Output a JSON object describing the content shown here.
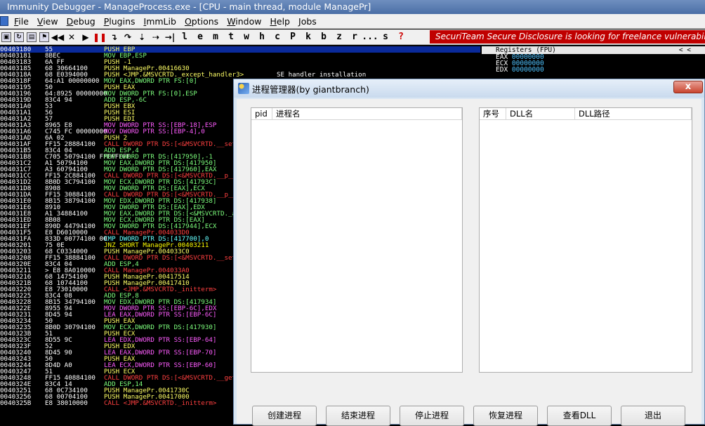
{
  "window": {
    "title": "Immunity Debugger - ManageProcess.exe - [CPU - main thread, module ManagePr]"
  },
  "menu": [
    "File",
    "View",
    "Debug",
    "Plugins",
    "ImmLib",
    "Options",
    "Window",
    "Help",
    "Jobs"
  ],
  "toolbar": {
    "letters": [
      "l",
      "e",
      "m",
      "t",
      "w",
      "h",
      "c",
      "P",
      "k",
      "b",
      "z",
      "r",
      "...",
      "s",
      "?"
    ],
    "banner": "SecuriTeam Secure Disclosure is looking for freelance vulnerability researchers"
  },
  "registers": {
    "header": "Registers (FPU)",
    "arrows": "<      <",
    "rows": [
      {
        "name": "EAX",
        "value": "00000000"
      },
      {
        "name": "ECX",
        "value": "00000000"
      },
      {
        "name": "EDX",
        "value": "00000000"
      }
    ]
  },
  "disasm": [
    {
      "addr": "00403180",
      "hex": "55",
      "asm": "PUSH EBP",
      "cmt": "",
      "kind": "push",
      "selected": true
    },
    {
      "addr": "00403181",
      "hex": "8BEC",
      "asm": "MOV EBP,ESP",
      "cmt": "",
      "kind": "def"
    },
    {
      "addr": "00403183",
      "hex": "6A FF",
      "asm": "PUSH -1",
      "cmt": "",
      "kind": "push"
    },
    {
      "addr": "00403185",
      "hex": "68 30664100",
      "asm": "PUSH ManagePr.00416630",
      "cmt": "",
      "kind": "push"
    },
    {
      "addr": "0040318A",
      "hex": "68 E0394000",
      "asm": "PUSH <JMP.&MSVCRTD._except_handler3>",
      "cmt": "SE handler installation",
      "kind": "push"
    },
    {
      "addr": "0040318F",
      "hex": "64:A1 00000000",
      "asm": "MOV EAX,DWORD PTR FS:[0]",
      "cmt": "",
      "kind": "def"
    },
    {
      "addr": "00403195",
      "hex": "50",
      "asm": "PUSH EAX",
      "cmt": "",
      "kind": "push"
    },
    {
      "addr": "00403196",
      "hex": "64:8925 00000000",
      "asm": "MOV DWORD PTR FS:[0],ESP",
      "cmt": "",
      "kind": "def"
    },
    {
      "addr": "0040319D",
      "hex": "83C4 94",
      "asm": "ADD ESP,-6C",
      "cmt": "",
      "kind": "def"
    },
    {
      "addr": "004031A0",
      "hex": "53",
      "asm": "PUSH EBX",
      "cmt": "",
      "kind": "push"
    },
    {
      "addr": "004031A1",
      "hex": "56",
      "asm": "PUSH ESI",
      "cmt": "",
      "kind": "push"
    },
    {
      "addr": "004031A2",
      "hex": "57",
      "asm": "PUSH EDI",
      "cmt": "",
      "kind": "push"
    },
    {
      "addr": "004031A3",
      "hex": "8965 E8",
      "asm": "MOV DWORD PTR SS:[EBP-18],ESP",
      "cmt": "",
      "kind": "mem"
    },
    {
      "addr": "004031A6",
      "hex": "C745 FC 00000000",
      "asm": "MOV DWORD PTR SS:[EBP-4],0",
      "cmt": "",
      "kind": "mem"
    },
    {
      "addr": "004031AD",
      "hex": "6A 02",
      "asm": "PUSH 2",
      "cmt": "",
      "kind": "push"
    },
    {
      "addr": "004031AF",
      "hex": "FF15 28884100",
      "asm": "CALL DWORD PTR DS:[<&MSVCRTD.__set_app_type>]",
      "cmt": "",
      "kind": "call"
    },
    {
      "addr": "004031B5",
      "hex": "83C4 04",
      "asm": "ADD ESP,4",
      "cmt": "",
      "kind": "def"
    },
    {
      "addr": "004031B8",
      "hex": "C705 50794100 FFFFFFFF",
      "asm": "MOV DWORD PTR DS:[417950],-1",
      "cmt": "",
      "kind": "def"
    },
    {
      "addr": "004031C2",
      "hex": "A1 50794100",
      "asm": "MOV EAX,DWORD PTR DS:[417950]",
      "cmt": "",
      "kind": "def"
    },
    {
      "addr": "004031C7",
      "hex": "A3 60794100",
      "asm": "MOV DWORD PTR DS:[417960],EAX",
      "cmt": "",
      "kind": "def"
    },
    {
      "addr": "004031CC",
      "hex": "FF15 2C884100",
      "asm": "CALL DWORD PTR DS:[<&MSVCRTD.__p__fmode>]",
      "cmt": "",
      "kind": "call"
    },
    {
      "addr": "004031D2",
      "hex": "8B0D 3C794100",
      "asm": "MOV ECX,DWORD PTR DS:[41793C]",
      "cmt": "",
      "kind": "def"
    },
    {
      "addr": "004031D8",
      "hex": "8908",
      "asm": "MOV DWORD PTR DS:[EAX],ECX",
      "cmt": "",
      "kind": "def"
    },
    {
      "addr": "004031DA",
      "hex": "FF15 30884100",
      "asm": "CALL DWORD PTR DS:[<&MSVCRTD.__p__commode>]",
      "cmt": "",
      "kind": "call"
    },
    {
      "addr": "004031E0",
      "hex": "8B15 38794100",
      "asm": "MOV EDX,DWORD PTR DS:[417938]",
      "cmt": "",
      "kind": "def"
    },
    {
      "addr": "004031E6",
      "hex": "8910",
      "asm": "MOV DWORD PTR DS:[EAX],EDX",
      "cmt": "",
      "kind": "def"
    },
    {
      "addr": "004031E8",
      "hex": "A1 34884100",
      "asm": "MOV EAX,DWORD PTR DS:[<&MSVCRTD._adjust_fdiv>]",
      "cmt": "",
      "kind": "def"
    },
    {
      "addr": "004031ED",
      "hex": "8B08",
      "asm": "MOV ECX,DWORD PTR DS:[EAX]",
      "cmt": "",
      "kind": "def"
    },
    {
      "addr": "004031EF",
      "hex": "890D 44794100",
      "asm": "MOV DWORD PTR DS:[417944],ECX",
      "cmt": "",
      "kind": "def"
    },
    {
      "addr": "004031F5",
      "hex": "E8 D6010000",
      "asm": "CALL ManagePr.004033D0",
      "cmt": "",
      "kind": "call"
    },
    {
      "addr": "004031FA",
      "hex": "833D 00774100 00",
      "asm": "CMP DWORD PTR DS:[417700],0",
      "cmt": "",
      "kind": "cmp"
    },
    {
      "addr": "00403201",
      "hex": "75 0E",
      "asm": "JNZ SHORT ManagePr.00403211",
      "cmt": "",
      "kind": "jmp"
    },
    {
      "addr": "00403203",
      "hex": "68 C0334000",
      "asm": "PUSH ManagePr.004033C0",
      "cmt": "",
      "kind": "push"
    },
    {
      "addr": "00403208",
      "hex": "FF15 38884100",
      "asm": "CALL DWORD PTR DS:[<&MSVCRTD.__setusermatherr>]",
      "cmt": "",
      "kind": "call"
    },
    {
      "addr": "0040320E",
      "hex": "83C4 04",
      "asm": "ADD ESP,4",
      "cmt": "",
      "kind": "def"
    },
    {
      "addr": "00403211",
      "hex": "> E8 8A010000",
      "asm": "CALL ManagePr.004033A0",
      "cmt": "",
      "kind": "call"
    },
    {
      "addr": "00403216",
      "hex": "68 14754100",
      "asm": "PUSH ManagePr.00417514",
      "cmt": "",
      "kind": "push"
    },
    {
      "addr": "0040321B",
      "hex": "68 10744100",
      "asm": "PUSH ManagePr.00417410",
      "cmt": "",
      "kind": "push"
    },
    {
      "addr": "00403220",
      "hex": "E8 73010000",
      "asm": "CALL <JMP.&MSVCRTD._initterm>",
      "cmt": "",
      "kind": "call"
    },
    {
      "addr": "00403225",
      "hex": "83C4 08",
      "asm": "ADD ESP,8",
      "cmt": "",
      "kind": "def"
    },
    {
      "addr": "00403228",
      "hex": "8B15 34794100",
      "asm": "MOV EDX,DWORD PTR DS:[417934]",
      "cmt": "",
      "kind": "def"
    },
    {
      "addr": "0040322E",
      "hex": "8955 94",
      "asm": "MOV DWORD PTR SS:[EBP-6C],EDX",
      "cmt": "",
      "kind": "mem"
    },
    {
      "addr": "00403231",
      "hex": "8D45 94",
      "asm": "LEA EAX,DWORD PTR SS:[EBP-6C]",
      "cmt": "",
      "kind": "mem"
    },
    {
      "addr": "00403234",
      "hex": "50",
      "asm": "PUSH EAX",
      "cmt": "",
      "kind": "push"
    },
    {
      "addr": "00403235",
      "hex": "8B0D 30794100",
      "asm": "MOV ECX,DWORD PTR DS:[417930]",
      "cmt": "",
      "kind": "def"
    },
    {
      "addr": "0040323B",
      "hex": "51",
      "asm": "PUSH ECX",
      "cmt": "",
      "kind": "push"
    },
    {
      "addr": "0040323C",
      "hex": "8D55 9C",
      "asm": "LEA EDX,DWORD PTR SS:[EBP-64]",
      "cmt": "",
      "kind": "mem"
    },
    {
      "addr": "0040323F",
      "hex": "52",
      "asm": "PUSH EDX",
      "cmt": "",
      "kind": "push"
    },
    {
      "addr": "00403240",
      "hex": "8D45 90",
      "asm": "LEA EAX,DWORD PTR SS:[EBP-70]",
      "cmt": "",
      "kind": "mem"
    },
    {
      "addr": "00403243",
      "hex": "50",
      "asm": "PUSH EAX",
      "cmt": "",
      "kind": "push"
    },
    {
      "addr": "00403244",
      "hex": "8D4D A0",
      "asm": "LEA ECX,DWORD PTR SS:[EBP-60]",
      "cmt": "",
      "kind": "mem"
    },
    {
      "addr": "00403247",
      "hex": "51",
      "asm": "PUSH ECX",
      "cmt": "",
      "kind": "push"
    },
    {
      "addr": "00403248",
      "hex": "FF15 40884100",
      "asm": "CALL DWORD PTR DS:[<&MSVCRTD.__getmainargs>]",
      "cmt": "",
      "kind": "call"
    },
    {
      "addr": "0040324E",
      "hex": "83C4 14",
      "asm": "ADD ESP,14",
      "cmt": "",
      "kind": "def"
    },
    {
      "addr": "00403251",
      "hex": "68 0C734100",
      "asm": "PUSH ManagePr.0041730C",
      "cmt": "",
      "kind": "push"
    },
    {
      "addr": "00403256",
      "hex": "68 00704100",
      "asm": "PUSH ManagePr.00417000",
      "cmt": "",
      "kind": "push"
    },
    {
      "addr": "0040325B",
      "hex": "E8 38010000",
      "asm": "CALL <JMP.&MSVCRTD._initterm>",
      "cmt": "",
      "kind": "call"
    }
  ],
  "dialog": {
    "title": "进程管理器(by giantbranch)",
    "close": "x",
    "process_list": {
      "columns": [
        "pid",
        "进程名"
      ]
    },
    "dll_list": {
      "columns": [
        "序号",
        "DLL名",
        "DLL路径"
      ]
    },
    "buttons": {
      "create": "创建进程",
      "end": "结束进程",
      "suspend": "停止进程",
      "resume": "恢复进程",
      "view_dll": "查看DLL",
      "exit": "退出"
    }
  }
}
